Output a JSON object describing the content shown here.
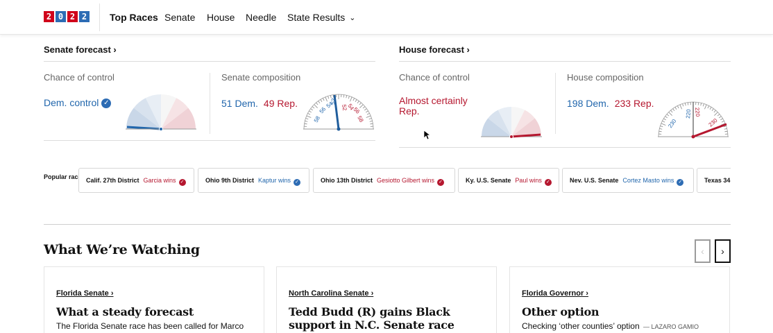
{
  "logo": {
    "digits": [
      "2",
      "0",
      "2",
      "2"
    ]
  },
  "nav": {
    "items": [
      {
        "label": "Top Races",
        "active": true
      },
      {
        "label": "Senate"
      },
      {
        "label": "House"
      },
      {
        "label": "Needle"
      },
      {
        "label": "State Results",
        "dropdown": true
      }
    ]
  },
  "senate": {
    "title": "Senate forecast ›",
    "control_label": "Chance of control",
    "control_value": "Dem. control",
    "control_value_verified": true,
    "composition_label": "Senate composition",
    "dem_count": "51 Dem.",
    "rep_count": "49 Rep.",
    "gauge_ticks": [
      "58",
      "56",
      "54",
      "52",
      "52",
      "54",
      "56",
      "58"
    ]
  },
  "house": {
    "title": "House forecast ›",
    "control_label": "Chance of control",
    "control_value": "Almost certainly Rep.",
    "composition_label": "House composition",
    "dem_count": "198 Dem.",
    "rep_count": "233 Rep.",
    "gauge_ticks": [
      "230",
      "220",
      "220",
      "230"
    ]
  },
  "popular": {
    "label": "Popular races",
    "races": [
      {
        "race": "Calif. 27th District",
        "result": "Garcia wins",
        "party": "r"
      },
      {
        "race": "Ohio 9th District",
        "result": "Kaptur wins",
        "party": "d"
      },
      {
        "race": "Ohio 13th District",
        "result": "Gesiotto Gilbert wins",
        "party": "r"
      },
      {
        "race": "Ky. U.S. Senate",
        "result": "Paul wins",
        "party": "r"
      },
      {
        "race": "Nev. U.S. Senate",
        "result": "Cortez Masto wins",
        "party": "d"
      },
      {
        "race": "Texas 34",
        "result": "",
        "party": ""
      }
    ]
  },
  "watching": {
    "title": "What We’re Watching",
    "prev_icon": "chevron-left-icon",
    "next_icon": "chevron-right-icon",
    "cards": [
      {
        "kicker": "Florida Senate ›",
        "headline": "What a steady forecast",
        "summary": "The Florida Senate race has been called for Marco",
        "byline": ""
      },
      {
        "kicker": "North Carolina Senate ›",
        "headline": "Tedd Budd (R) gains Black support in N.C. Senate race",
        "summary": "",
        "byline": ""
      },
      {
        "kicker": "Florida Governor ›",
        "headline": "Other option",
        "summary": "Checking ‘other counties’ option",
        "byline": "— LAZARO GAMIO"
      }
    ]
  },
  "colors": {
    "dem": "#2166ac",
    "rep": "#b5172f",
    "logo_red": "#d0021b",
    "logo_blue": "#2d6cb4"
  }
}
